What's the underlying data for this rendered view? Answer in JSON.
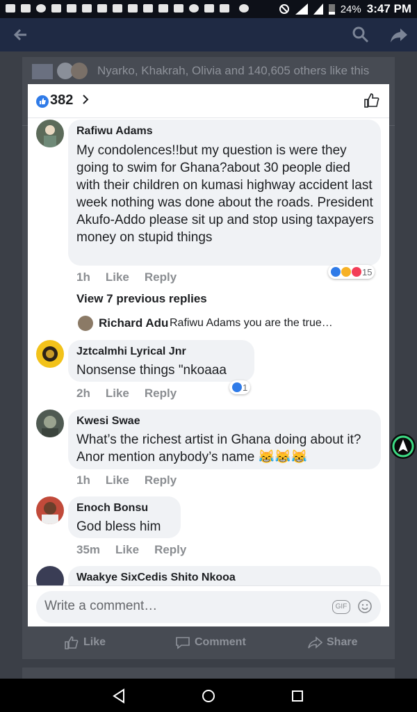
{
  "status_bar": {
    "battery": "24%",
    "time": "3:47 PM"
  },
  "feed": {
    "likers_text": "Nyarko, Khakrah, Olivia and 140,605 others like this",
    "actions": {
      "like": "Like",
      "comment": "Comment",
      "share": "Share"
    }
  },
  "popup": {
    "like_count": "382",
    "comments": [
      {
        "name": "Rafiwu Adams",
        "text": "My condolences!!but my question is were they going to swim for Ghana?about 30 people died with their children on kumasi highway accident last week nothing was done about the roads. President Akufo-Addo please sit up and stop using taxpayers money on stupid things",
        "time": "1h",
        "like": "Like",
        "reply": "Reply",
        "reactions": "15"
      },
      {
        "name": "Jztcalmhi Lyrical Jnr",
        "text": "Nonsense things \"nkoaaa",
        "time": "2h",
        "like": "Like",
        "reply": "Reply",
        "reactions": "1"
      },
      {
        "name": "Kwesi Swae",
        "text": "What’s the richest artist in Ghana doing about it? Anor mention anybody’s name",
        "time": "1h",
        "like": "Like",
        "reply": "Reply"
      },
      {
        "name": "Enoch Bonsu",
        "text": "God bless him",
        "time": "35m",
        "like": "Like",
        "reply": "Reply"
      },
      {
        "name": "Waakye SixCedis Shito Nkooa"
      }
    ],
    "view_previous": "View 7 previous replies",
    "reply_preview": {
      "name": "Richard Adu",
      "text": "Rafiwu Adams you are the true…"
    },
    "composer": {
      "placeholder": "Write a comment…",
      "gif": "GIF"
    }
  },
  "colors": {
    "accent": "#2f7be8",
    "app_bar": "#1f2a44"
  }
}
